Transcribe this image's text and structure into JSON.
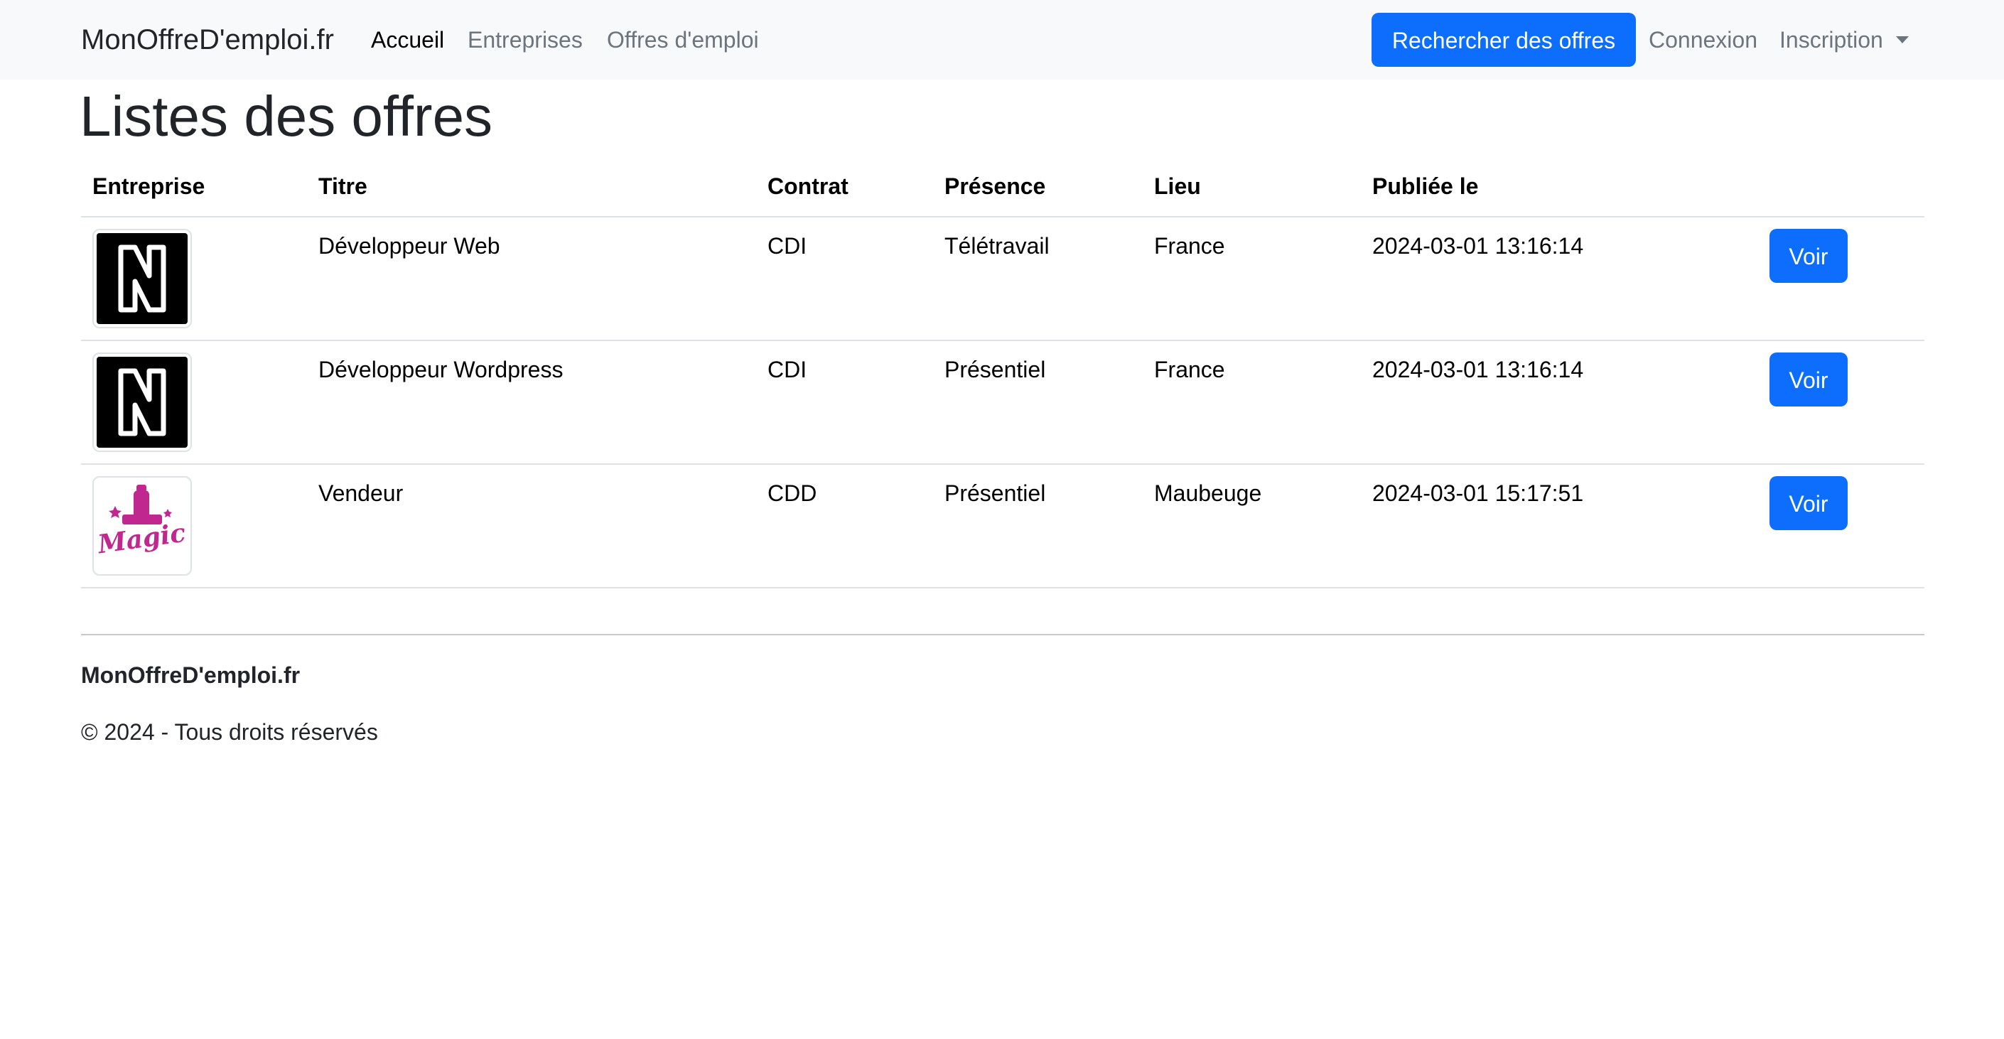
{
  "navbar": {
    "brand": "MonOffreD'emploi.fr",
    "links": [
      {
        "label": "Accueil",
        "active": true
      },
      {
        "label": "Entreprises",
        "active": false
      },
      {
        "label": "Offres d'emploi",
        "active": false
      }
    ],
    "search_button": "Rechercher des offres",
    "connexion": "Connexion",
    "inscription": "Inscription"
  },
  "page": {
    "title": "Listes des offres"
  },
  "table": {
    "headers": [
      "Entreprise",
      "Titre",
      "Contrat",
      "Présence",
      "Lieu",
      "Publiée le"
    ],
    "rows": [
      {
        "logo": "n-logo-icon",
        "title": "Développeur Web",
        "contract": "CDI",
        "presence": "Télétravail",
        "place": "France",
        "published": "2024-03-01 13:16:14",
        "action": "Voir"
      },
      {
        "logo": "n-logo-icon",
        "title": "Développeur Wordpress",
        "contract": "CDI",
        "presence": "Présentiel",
        "place": "France",
        "published": "2024-03-01 13:16:14",
        "action": "Voir"
      },
      {
        "logo": "magic-logo-icon",
        "logo_text": "Magic",
        "title": "Vendeur",
        "contract": "CDD",
        "presence": "Présentiel",
        "place": "Maubeuge",
        "published": "2024-03-01 15:17:51",
        "action": "Voir"
      }
    ]
  },
  "footer": {
    "brand": "MonOffreD'emploi.fr",
    "copyright": "© 2024 - Tous droits réservés"
  },
  "colors": {
    "primary": "#0d6efd",
    "navbar_bg": "#f8f9fa",
    "magic_pink": "#c0288f"
  }
}
